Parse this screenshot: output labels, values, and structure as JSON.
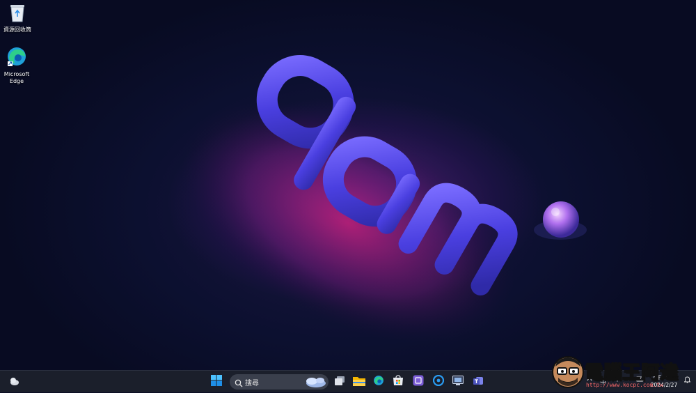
{
  "desktop": {
    "icons": [
      {
        "label": "資源回收筒",
        "icon": "recycle-bin-icon"
      },
      {
        "label": "Microsoft Edge",
        "icon": "edge-icon"
      }
    ]
  },
  "taskbar": {
    "search_placeholder": "搜尋",
    "apps": [
      "start-icon",
      "search-icon",
      "task-view-icon",
      "file-explorer-icon",
      "edge-icon",
      "microsoft-store-icon",
      "copilot-icon",
      "cortana-icon",
      "remote-desktop-icon",
      "teams-icon"
    ],
    "tray": {
      "input_indicator": "中",
      "time": "下午04:54",
      "date": "2024/2/27"
    }
  },
  "watermark": {
    "text": "電腦王阿達",
    "url": "http://www.kocpc.com.tw"
  },
  "colors": {
    "taskbar_bg": "#1b1f2b",
    "accent": "#3b8fe8",
    "wallpaper_letters": "#5a4cf0"
  }
}
